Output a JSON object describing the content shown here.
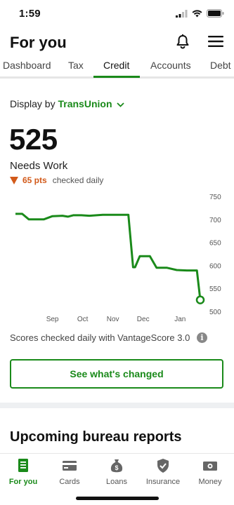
{
  "status": {
    "time": "1:59"
  },
  "header": {
    "title": "For you"
  },
  "tabs": [
    {
      "label": "Dashboard"
    },
    {
      "label": "Tax"
    },
    {
      "label": "Credit"
    },
    {
      "label": "Accounts"
    },
    {
      "label": "Debt"
    }
  ],
  "credit": {
    "display_by_label": "Display by",
    "bureau": "TransUnion",
    "score": "525",
    "rating": "Needs Work",
    "delta": "65 pts",
    "delta_note": "checked daily",
    "footnote": "Scores checked daily with VantageScore 3.0",
    "cta_label": "See what's changed"
  },
  "section": {
    "title": "Upcoming bureau reports"
  },
  "bottom_nav": [
    {
      "label": "For you"
    },
    {
      "label": "Cards"
    },
    {
      "label": "Loans"
    },
    {
      "label": "Insurance"
    },
    {
      "label": "Money"
    }
  ],
  "colors": {
    "accent": "#1a8a1a",
    "delta": "#d25a1a"
  },
  "chart_data": {
    "type": "line",
    "xlabel": "",
    "ylabel": "",
    "x_ticks": [
      "Sep",
      "Oct",
      "Nov",
      "Dec",
      "Jan"
    ],
    "y_ticks": [
      750,
      700,
      650,
      600,
      550,
      500
    ],
    "ylim": [
      500,
      750
    ],
    "x": [
      0,
      10,
      20,
      33,
      42,
      55,
      70,
      78,
      86,
      98,
      110,
      130,
      145,
      160,
      168,
      175,
      178,
      185,
      200,
      210,
      225,
      240,
      255,
      270,
      275
    ],
    "values": [
      712,
      712,
      700,
      700,
      700,
      707,
      708,
      706,
      709,
      709,
      708,
      710,
      710,
      710,
      710,
      596,
      596,
      620,
      620,
      595,
      595,
      590,
      589,
      589,
      525
    ],
    "x_tick_positions": [
      55,
      100,
      145,
      190,
      245
    ],
    "grid": false
  }
}
